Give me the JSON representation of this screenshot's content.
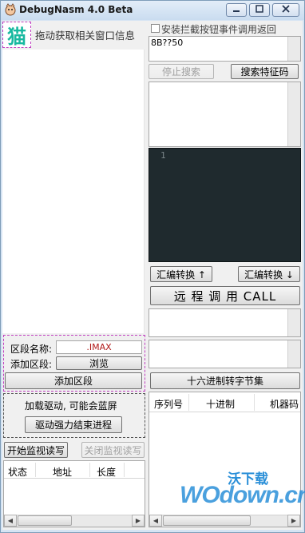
{
  "window": {
    "title": "DebugNasm 4.0 Beta",
    "controls": [
      "minimize-icon",
      "maximize-icon",
      "close-icon"
    ]
  },
  "drag_picker": {
    "label": "拖动获取相关窗口信息",
    "glyph": "猫"
  },
  "intercept_checkbox": {
    "label": "安装拦截按钮事件调用返回",
    "checked": false
  },
  "search": {
    "pattern_value": "8B??50",
    "stop_label": "停止搜索",
    "search_label": "搜索特征码"
  },
  "editor": {
    "line_number": "1"
  },
  "asm": {
    "convert_up_label": "汇编转换 ↑",
    "convert_down_label": "汇编转换 ↓",
    "remote_call_label": "远 程 调 用  CALL"
  },
  "hex_to_bytes_label": "十六进制转字节集",
  "section": {
    "name_label": "区段名称:",
    "name_value": ".IMAX",
    "add_label": "添加区段:",
    "browse_label": "浏览",
    "add_button": "添加区段"
  },
  "driver": {
    "warning": "加载驱动, 可能会蓝屏",
    "kill_button": "驱动强力结束进程"
  },
  "monitor": {
    "start_label": "开始监视读写",
    "stop_label": "关闭监视读写",
    "columns": [
      "状态",
      "地址",
      "长度"
    ]
  },
  "bytes_table": {
    "columns": [
      "序列号",
      "十进制",
      "机器码"
    ]
  },
  "watermark": {
    "brand": "WOdown.cn",
    "chinese": "沃下载"
  },
  "colors": {
    "editor_bg": "#1f2a2e",
    "accent_pink": "#c040c0",
    "section_value": "#b01818",
    "watermark_blue": "#2a8fd8"
  }
}
